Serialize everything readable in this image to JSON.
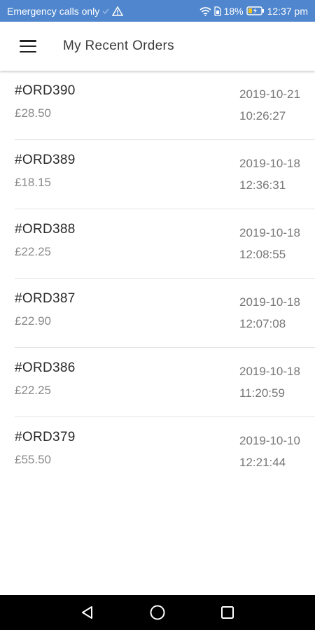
{
  "status_bar": {
    "carrier_text": "Emergency calls only",
    "battery_percent": "18%",
    "time": "12:37 pm",
    "background_color": "#4f86cd"
  },
  "app_bar": {
    "menu_icon": "hamburger-menu-icon",
    "title": "My Recent Orders"
  },
  "orders": [
    {
      "id": "#ORD390",
      "total": "£28.50",
      "date": "2019-10-21",
      "time": "10:26:27"
    },
    {
      "id": "#ORD389",
      "total": "£18.15",
      "date": "2019-10-18",
      "time": "12:36:31"
    },
    {
      "id": "#ORD388",
      "total": "£22.25",
      "date": "2019-10-18",
      "time": "12:08:55"
    },
    {
      "id": "#ORD387",
      "total": "£22.90",
      "date": "2019-10-18",
      "time": "12:07:08"
    },
    {
      "id": "#ORD386",
      "total": "£22.25",
      "date": "2019-10-18",
      "time": "11:20:59"
    },
    {
      "id": "#ORD379",
      "total": "£55.50",
      "date": "2019-10-10",
      "time": "12:21:44"
    }
  ],
  "nav_bar": {
    "back_icon": "back-triangle-icon",
    "home_icon": "home-circle-icon",
    "recents_icon": "recents-square-icon"
  }
}
